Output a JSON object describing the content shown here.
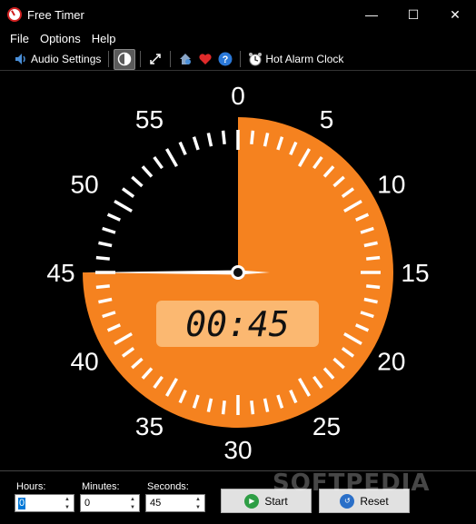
{
  "window": {
    "title": "Free Timer",
    "minimize": "—",
    "maximize": "☐",
    "close": "✕"
  },
  "menu": {
    "file": "File",
    "options": "Options",
    "help": "Help"
  },
  "toolbar": {
    "audio_settings": "Audio Settings",
    "hot_alarm_clock": "Hot Alarm Clock"
  },
  "clock": {
    "labels": [
      "0",
      "5",
      "10",
      "15",
      "20",
      "25",
      "30",
      "35",
      "40",
      "45",
      "50",
      "55"
    ],
    "digital_display": "00:45",
    "remaining_seconds": 45,
    "face_color": "#f5821f",
    "display_color": "#fbb871"
  },
  "controls": {
    "hours_label": "Hours:",
    "hours_value": "0",
    "minutes_label": "Minutes:",
    "minutes_value": "0",
    "seconds_label": "Seconds:",
    "seconds_value": "45",
    "start_label": "Start",
    "reset_label": "Reset"
  },
  "watermark": "SOFTPEDIA"
}
